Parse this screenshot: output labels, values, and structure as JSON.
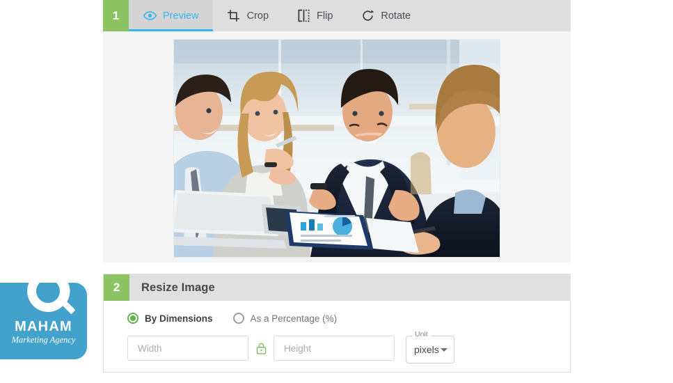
{
  "editor": {
    "step1_number": "1",
    "tabs": [
      {
        "label": "Preview",
        "icon": "eye-icon",
        "active": true
      },
      {
        "label": "Crop",
        "icon": "crop-icon",
        "active": false
      },
      {
        "label": "Flip",
        "icon": "flip-icon",
        "active": false
      },
      {
        "label": "Rotate",
        "icon": "rotate-icon",
        "active": false
      }
    ],
    "preview_image_alt": "Business meeting photo - four colleagues at a white table"
  },
  "resize": {
    "step2_number": "2",
    "title": "Resize Image",
    "options": [
      {
        "label": "By Dimensions",
        "selected": true
      },
      {
        "label": "As a Percentage (%)",
        "selected": false
      }
    ],
    "width_field": {
      "value": "",
      "placeholder": "Width"
    },
    "height_field": {
      "value": "",
      "placeholder": "Height"
    },
    "lock_icon": "lock-icon",
    "unit": {
      "legend": "Unit",
      "value": "pixels"
    }
  },
  "watermark": {
    "name": "MAHAM",
    "tagline": "Marketing Agency"
  },
  "colors": {
    "step_green": "#8cc463",
    "active_blue": "#37b7f0",
    "radio_green": "#62b54a",
    "logo_blue": "#43a2cb",
    "tabbar_gray": "#dedede"
  }
}
